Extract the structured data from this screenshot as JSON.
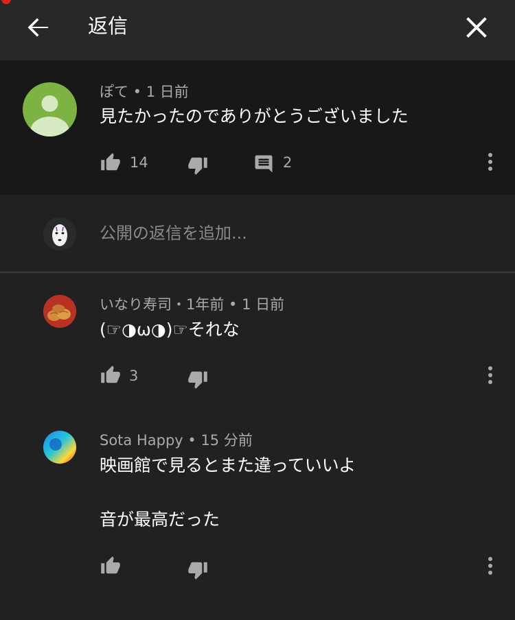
{
  "header": {
    "title": "返信",
    "back_icon": "arrow-left-icon",
    "close_icon": "close-icon"
  },
  "parent_comment": {
    "meta": "ぽて • 1 日前",
    "text": "見たかったのでありがとうございました",
    "likes": "14",
    "replies": "2",
    "avatar_color": "#7cb342"
  },
  "add_reply": {
    "placeholder": "公開の返信を追加..."
  },
  "replies": [
    {
      "meta": "いなり寿司・1年前 • 1 日前",
      "text": "(☞◑ω◑)☞それな",
      "likes": "3"
    },
    {
      "meta": "Sota Happy • 15 分前",
      "text_line1": "映画館で見るとまた違っていいよ",
      "text_line2": "音が最高だった",
      "likes": ""
    }
  ],
  "colors": {
    "background": "#212121",
    "header": "#282828",
    "parent_background": "#181818",
    "secondary_text": "#aaaaaa"
  }
}
